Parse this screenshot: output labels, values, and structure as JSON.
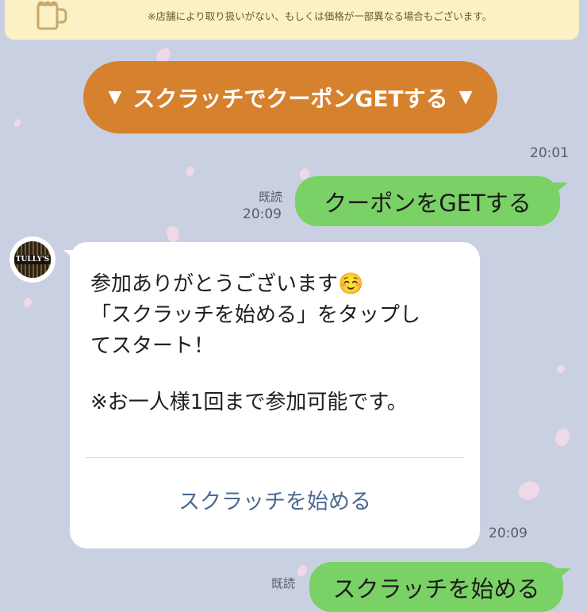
{
  "top_card": {
    "icon": "beer-mug-icon",
    "note": "※店舗により取り扱いがない、もしくは価格が一部異なる場合もございます。"
  },
  "coupon_button": {
    "label": "スクラッチでクーポンGETする",
    "arrow": "▼"
  },
  "times": {
    "t1": "20:01",
    "t2": "20:09",
    "t3": "20:09"
  },
  "read_label": "既読",
  "user_messages": {
    "first": "クーポンをGETする",
    "second": "スクラッチを始める"
  },
  "bot": {
    "avatar_text": "TULLY'S",
    "lines": [
      "参加ありがとうございます☺️",
      "「スクラッチを始める」をタップし",
      "てスタート！",
      "※お一人様1回まで参加可能です。"
    ],
    "action_label": "スクラッチを始める"
  },
  "colors": {
    "background": "#c9d0e2",
    "pill": "#d6812d",
    "user_bubble": "#7ad166",
    "link": "#4b6a92"
  }
}
